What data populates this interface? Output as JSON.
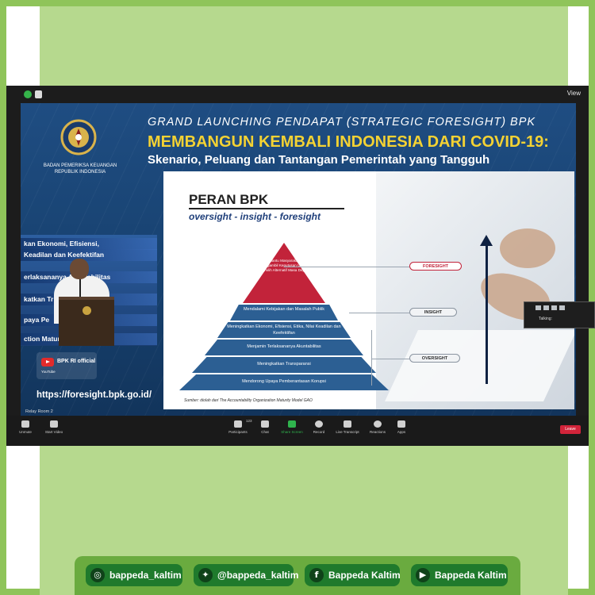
{
  "slide": {
    "title": "GRAND LAUNCHING PENDAPAT (STRATEGIC FORESIGHT) BPK",
    "heading": "MEMBANGUN KEMBALI INDONESIA DARI COVID-19:",
    "subheading": "Skenario, Peluang dan Tantangan Pemerintah yang Tangguh",
    "org_name": "BADAN PEMERIKSA KEUANGAN\nREPUBLIK INDONESIA",
    "peran_title": "PERAN BPK",
    "peran_sub": "oversight - insight - foresight",
    "pyramid_top": "Membantu Masyarakat dan Pengambil Keputusan Untuk Memilih Alternatif Masa Depan",
    "tiers": [
      "Mendalami Kebijakan dan Masalah Publik",
      "Meningkatkan Ekonomi, Efisiensi, Etika, Nilai Keadilan dan Keefektifan",
      "Menjamin Terlaksananya Akuntabilitas",
      "Meningkatkan Transparansi",
      "Mendorong Upaya Pemberantasan Korupsi"
    ],
    "labels": {
      "foresight": "FORESIGHT",
      "insight": "INSIGHT",
      "oversight": "OVERSIGHT"
    },
    "source": "Sumber: diolah dari The Accountability Organization Maturity Model GAO",
    "video_lines": [
      "kan Ekonomi, Efisiensi,",
      "Keadilan dan Keefektifan",
      "erlaksananya Akuntabilitas",
      "katkan Tr",
      "paya Pe",
      "ction Maturity"
    ],
    "youtube_name": "BPK RI official",
    "youtube_label": "YouTube",
    "website": "https://foresight.bpk.go.id/"
  },
  "zoom": {
    "view_label": "View",
    "talking_label": "Talking:",
    "speaking": "Relay Room 2",
    "toolbar": [
      {
        "label": "Unmute"
      },
      {
        "label": "Start Video"
      },
      {
        "label": "Participants"
      },
      {
        "label": "Chat"
      },
      {
        "label": "Share Screen"
      },
      {
        "label": "Record"
      },
      {
        "label": "Live Transcript"
      },
      {
        "label": "Reactions"
      },
      {
        "label": "Apps"
      }
    ],
    "participants_count": "123",
    "leave_label": "Leave"
  },
  "footer": [
    {
      "label": "bappeda_kaltim",
      "icon": "instagram-icon"
    },
    {
      "label": "@bappeda_kaltim",
      "icon": "twitter-icon"
    },
    {
      "label": "Bappeda Kaltim",
      "icon": "facebook-icon"
    },
    {
      "label": "Bappeda Kaltim",
      "icon": "youtube-icon"
    }
  ],
  "colors": {
    "frame": "#8fc45a",
    "panel": "#b6d98e",
    "heading_yellow": "#f4d233",
    "pyramid_top": "#c2233a",
    "tier_blue": "#2c5f93",
    "footer_pill": "#1f7a2c",
    "share_green": "#2fb34d",
    "leave_red": "#d2243a"
  }
}
